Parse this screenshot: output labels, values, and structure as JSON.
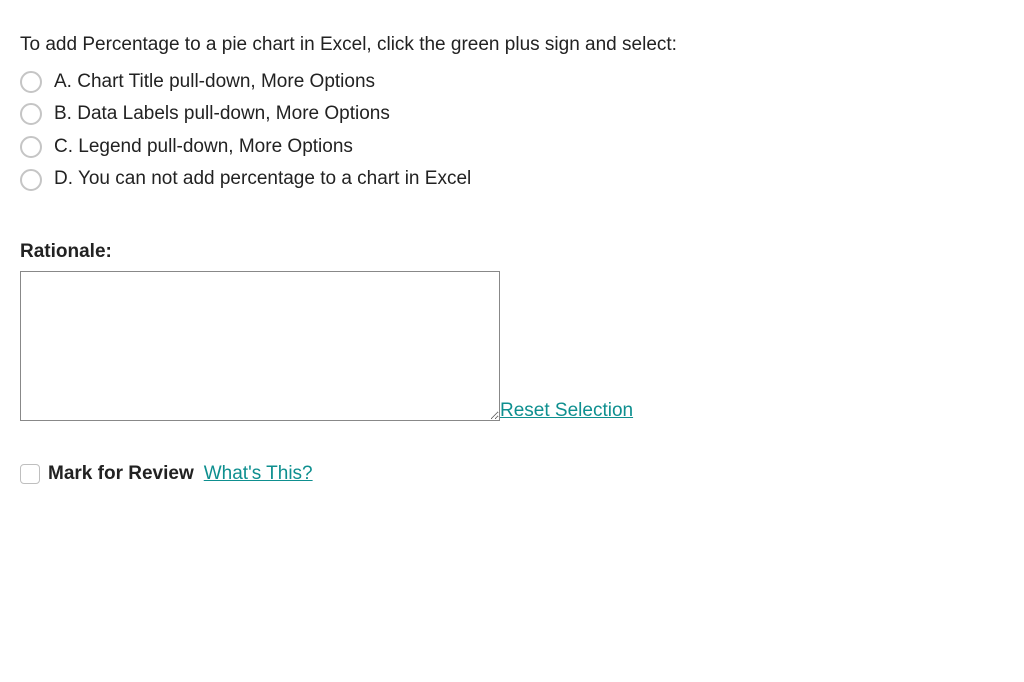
{
  "question": "To add Percentage to a pie chart in Excel, click the green plus sign and select:",
  "options": [
    {
      "letter": "A.",
      "text": "Chart Title pull-down, More Options"
    },
    {
      "letter": "B.",
      "text": "Data Labels pull-down, More Options"
    },
    {
      "letter": "C.",
      "text": "Legend pull-down, More Options"
    },
    {
      "letter": "D.",
      "text": "You can not add percentage to a chart in Excel"
    }
  ],
  "rationale_label": "Rationale:",
  "rationale_value": "",
  "reset_label": "Reset Selection",
  "mark_review_label": "Mark for Review",
  "whats_this_label": " What's This?"
}
